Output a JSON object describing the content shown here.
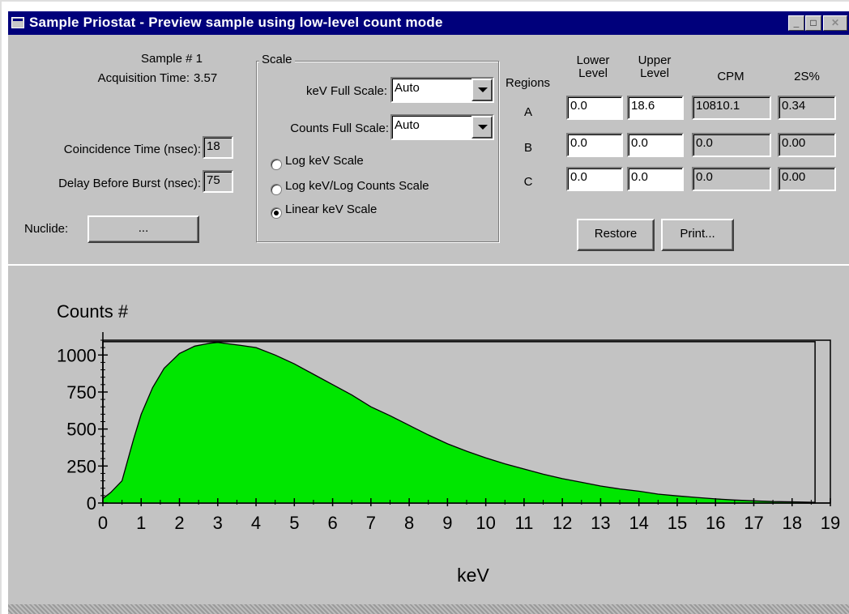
{
  "window": {
    "title": "Sample Priostat - Preview sample using low-level count mode",
    "controls": [
      "minimize-icon",
      "maximize-icon",
      "close-icon"
    ]
  },
  "sample": {
    "sample_label": "Sample # 1",
    "acq_label": "Acquisition Time:",
    "acq_value": "3.57"
  },
  "settings": {
    "coincidence_label": "Coincidence Time (nsec):",
    "coincidence_value": "18",
    "delay_label": "Delay Before Burst (nsec):",
    "delay_value": "75",
    "nuclide_label": "Nuclide:",
    "nuclide_button": "..."
  },
  "scale": {
    "legend": "Scale",
    "kev_label": "keV Full Scale:",
    "kev_value": "Auto",
    "counts_label": "Counts Full Scale:",
    "counts_value": "Auto",
    "options": [
      "Log keV Scale",
      "Log keV/Log Counts Scale",
      "Linear keV Scale"
    ],
    "selected": "Linear keV Scale"
  },
  "regions": {
    "header_regions": "Regions",
    "header_lower_1": "Lower",
    "header_lower_2": "Level",
    "header_upper_1": "Upper",
    "header_upper_2": "Level",
    "header_cpm": "CPM",
    "header_2s": "2S%",
    "rows": [
      {
        "name": "A",
        "lower": "0.0",
        "upper": "18.6",
        "cpm": "10810.1",
        "pct": "0.34"
      },
      {
        "name": "B",
        "lower": "0.0",
        "upper": "0.0",
        "cpm": "0.0",
        "pct": "0.00"
      },
      {
        "name": "C",
        "lower": "0.0",
        "upper": "0.0",
        "cpm": "0.0",
        "pct": "0.00"
      }
    ],
    "restore_button": "Restore",
    "print_button": "Print..."
  },
  "chart_data": {
    "type": "area",
    "title": "",
    "ylabel": "Counts #",
    "xlabel": "keV",
    "xlim": [
      0,
      19
    ],
    "ylim": [
      0,
      1100
    ],
    "x_ticks": [
      0,
      1,
      2,
      3,
      4,
      5,
      6,
      7,
      8,
      9,
      10,
      11,
      12,
      13,
      14,
      15,
      16,
      17,
      18,
      19
    ],
    "y_ticks": [
      0,
      250,
      500,
      750,
      1000
    ],
    "fill_color": "#00e600",
    "region_box": {
      "lower": 0.0,
      "upper": 18.6,
      "height": 1090
    },
    "series": [
      {
        "x": [
          0,
          0.2,
          0.5,
          0.8,
          1.0,
          1.3,
          1.6,
          2.0,
          2.4,
          2.8,
          3.0,
          3.3,
          3.6,
          4.0,
          4.5,
          5.0,
          5.5,
          6.0,
          6.5,
          7.0,
          7.5,
          8.0,
          8.5,
          9.0,
          9.5,
          10.0,
          10.5,
          11.0,
          11.5,
          12.0,
          12.5,
          13.0,
          13.5,
          14.0,
          14.5,
          15.0,
          15.5,
          16.0,
          16.5,
          17.0,
          17.5,
          18.0,
          18.6
        ],
        "y": [
          30,
          70,
          150,
          430,
          600,
          780,
          910,
          1010,
          1060,
          1080,
          1085,
          1075,
          1065,
          1050,
          1000,
          940,
          870,
          800,
          730,
          650,
          590,
          525,
          460,
          400,
          350,
          305,
          265,
          230,
          195,
          165,
          140,
          115,
          95,
          80,
          60,
          48,
          38,
          28,
          20,
          15,
          10,
          8,
          5
        ]
      }
    ]
  }
}
